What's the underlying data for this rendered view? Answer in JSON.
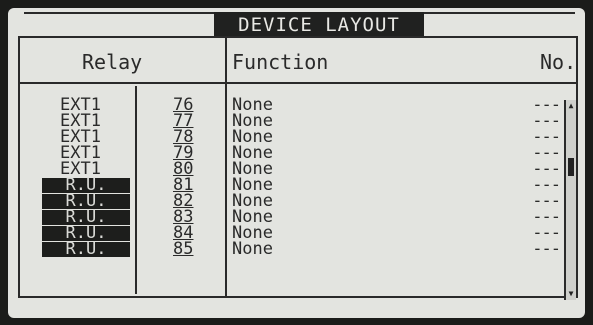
{
  "title": "DEVICE LAYOUT",
  "headers": {
    "relay": "Relay",
    "function": "Function",
    "no": "No."
  },
  "rows": [
    {
      "relay": "EXT1",
      "num": "76",
      "function": "None",
      "no": "---"
    },
    {
      "relay": "EXT1",
      "num": "77",
      "function": "None",
      "no": "---"
    },
    {
      "relay": "EXT1",
      "num": "78",
      "function": "None",
      "no": "---"
    },
    {
      "relay": "EXT1",
      "num": "79",
      "function": "None",
      "no": "---"
    },
    {
      "relay": "EXT1",
      "num": "80",
      "function": "None",
      "no": "---"
    },
    {
      "relay": "R.U.",
      "num": "81",
      "function": "None",
      "no": "---"
    },
    {
      "relay": "R.U.",
      "num": "82",
      "function": "None",
      "no": "---"
    },
    {
      "relay": "R.U.",
      "num": "83",
      "function": "None",
      "no": "---"
    },
    {
      "relay": "R.U.",
      "num": "84",
      "function": "None",
      "no": "---"
    },
    {
      "relay": "R.U.",
      "num": "85",
      "function": "None",
      "no": "---"
    }
  ],
  "scrollbar": {
    "up_icon": "triangle-up",
    "down_icon": "triangle-down"
  }
}
